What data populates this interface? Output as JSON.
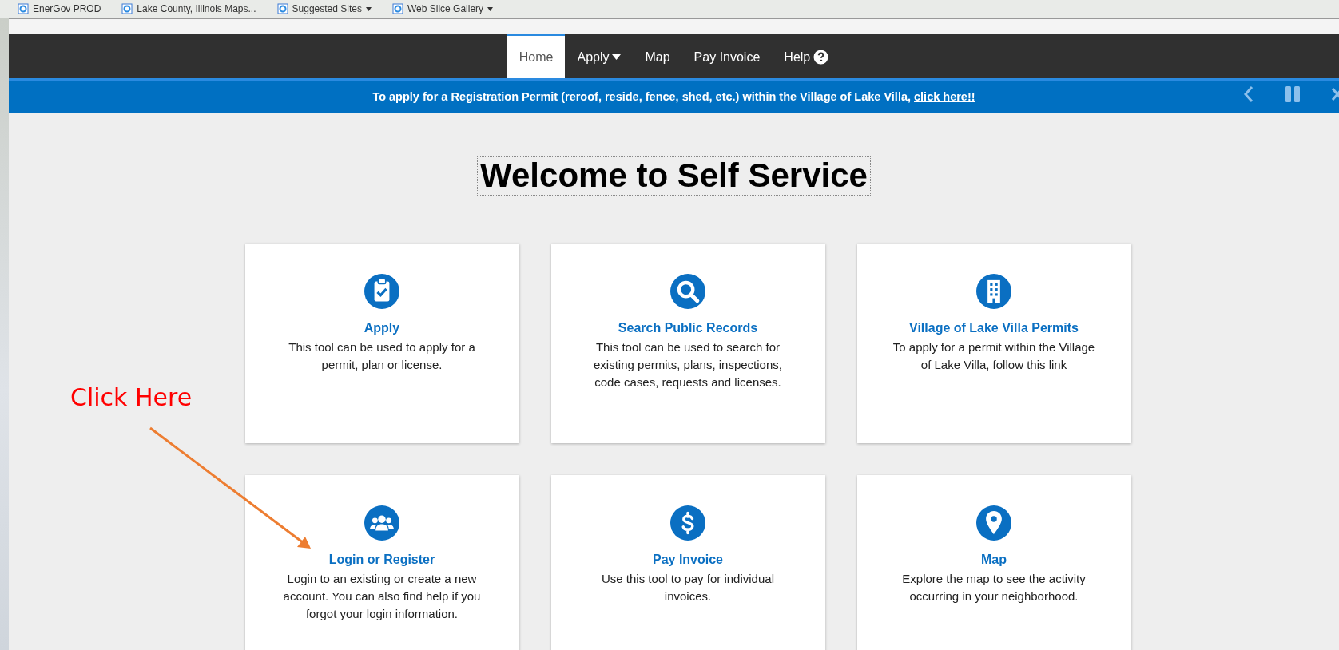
{
  "favorites_bar": [
    {
      "label": "EnerGov PROD",
      "kind": "link"
    },
    {
      "label": "Lake County, Illinois Maps...",
      "kind": "link"
    },
    {
      "label": "Suggested Sites",
      "kind": "menu"
    },
    {
      "label": "Web Slice Gallery",
      "kind": "menu"
    }
  ],
  "nav": {
    "items": [
      {
        "label": "Home",
        "selected": true,
        "kind": "plain"
      },
      {
        "label": "Apply",
        "selected": false,
        "kind": "menu"
      },
      {
        "label": "Map",
        "selected": false,
        "kind": "plain"
      },
      {
        "label": "Pay Invoice",
        "selected": false,
        "kind": "plain"
      },
      {
        "label": "Help",
        "selected": false,
        "kind": "help"
      }
    ]
  },
  "banner": {
    "text": "To apply for a Registration Permit (reroof, reside, fence, shed, etc.) within the Village of Lake Villa,",
    "link": "click here!!"
  },
  "title": "Welcome to Self Service",
  "cards": [
    {
      "kind": "clipboard",
      "title": "Apply",
      "description": "This tool can be used to apply for a permit, plan or license."
    },
    {
      "kind": "search",
      "title": "Search Public Records",
      "description": "This tool can be used to search for existing permits, plans, inspections, code cases, requests and licenses."
    },
    {
      "kind": "building",
      "title": "Village of Lake Villa Permits",
      "description": "To apply for a permit within the Village of Lake Villa, follow this link"
    },
    {
      "kind": "users",
      "title": "Login or Register",
      "description": "Login to an existing or create a new account. You can also find help if you forgot your login information."
    },
    {
      "kind": "dollar",
      "title": "Pay Invoice",
      "description": "Use this tool to pay for individual invoices."
    },
    {
      "kind": "pin",
      "title": "Map",
      "description": "Explore the map to see the activity occurring in your neighborhood."
    }
  ],
  "annotation": {
    "text": "Click Here"
  }
}
